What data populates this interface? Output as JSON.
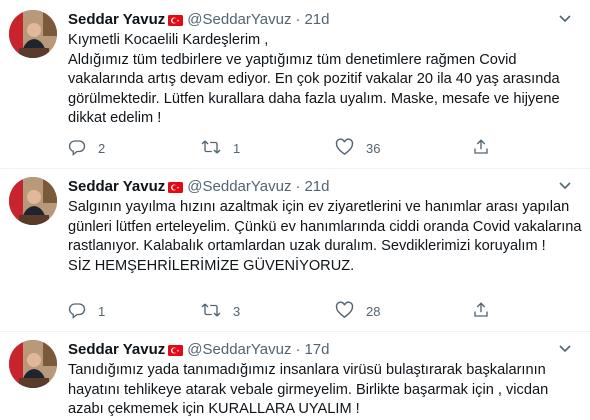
{
  "tweets": [
    {
      "name": "Seddar Yavuz",
      "handle": "@SeddarYavuz",
      "time": "21d",
      "text": "Kıymetli Kocaelili Kardeşlerim ,\nAldığımız tüm tedbirlere ve yaptığımız tüm denetimlere rağmen Covid vakalarında artış devam ediyor. En çok pozitif vakalar 20 ila 40 yaş arasında görülmektedir. Lütfen kurallara daha fazla uyalım. Maske, mesafe ve hijyene dikkat edelim !",
      "replies": "2",
      "retweets": "1",
      "likes": "36"
    },
    {
      "name": "Seddar Yavuz",
      "handle": "@SeddarYavuz",
      "time": "21d",
      "text": "Salgının yayılma hızını azaltmak için ev ziyaretlerini ve hanımlar arası yapılan günleri lütfen erteleyelim. Çünkü ev hanımlarında ciddi oranda Covid vakalarına rastlanıyor. Kalabalık ortamlardan uzak duralım. Sevdiklerimizi koruyalım !\nSİZ HEMŞEHRİLERİMİZE GÜVENİYORUZ.",
      "replies": "1",
      "retweets": "3",
      "likes": "28"
    },
    {
      "name": "Seddar Yavuz",
      "handle": "@SeddarYavuz",
      "time": "17d",
      "text": "Tanıdığımız yada tanımadığımız insanlara virüsü bulaştırarak başkalarının hayatını tehlikeye atarak vebale girmeyelim. Birlikte başarmak için , vicdan azabı çekmemek için KURALLARA UYALIM !",
      "replies": "",
      "retweets": "",
      "likes": ""
    }
  ],
  "colors": {
    "text": "#0f1419",
    "muted": "#536471",
    "flag": "#e30a17",
    "divider": "#eff3f4"
  },
  "icons": {
    "reply": "reply-icon",
    "retweet": "retweet-icon",
    "like": "heart-icon",
    "share": "share-icon",
    "more": "chevron-down-icon",
    "flag": "turkey-flag-icon"
  }
}
